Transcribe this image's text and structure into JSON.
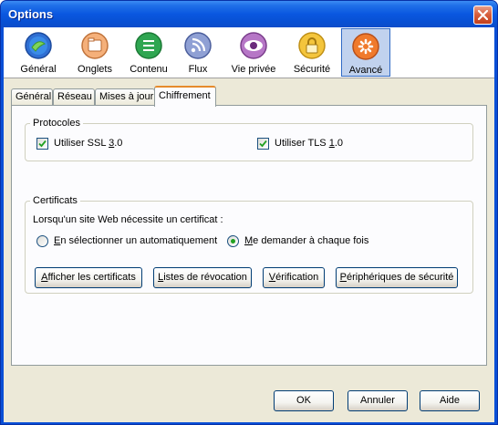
{
  "window": {
    "title": "Options"
  },
  "toolbar": {
    "items": [
      {
        "label": "Général",
        "icon": "general-icon"
      },
      {
        "label": "Onglets",
        "icon": "tabs-icon"
      },
      {
        "label": "Contenu",
        "icon": "content-icon"
      },
      {
        "label": "Flux",
        "icon": "feeds-icon"
      },
      {
        "label": "Vie privée",
        "icon": "privacy-icon"
      },
      {
        "label": "Sécurité",
        "icon": "security-icon"
      },
      {
        "label": "Avancé",
        "icon": "advanced-icon",
        "selected": true
      }
    ]
  },
  "subtabs": [
    "Général",
    "Réseau",
    "Mises à jour",
    "Chiffrement"
  ],
  "active_subtab": "Chiffrement",
  "protocols": {
    "title": "Protocoles",
    "ssl": {
      "label_pre": "Utiliser SSL ",
      "label_key": "3",
      "label_post": ".0",
      "checked": true
    },
    "tls": {
      "label_pre": "Utiliser TLS ",
      "label_key": "1",
      "label_post": ".0",
      "checked": true
    }
  },
  "certificates": {
    "title": "Certificats",
    "prompt": "Lorsqu'un site Web nécessite un certificat :",
    "auto": {
      "label_key": "E",
      "label_rest": "n sélectionner un automatiquement",
      "selected": false
    },
    "ask": {
      "label_key": "M",
      "label_rest": "e demander à chaque fois",
      "selected": true
    },
    "buttons": {
      "view_key": "A",
      "view_rest": "fficher les certificats",
      "revocation_key": "L",
      "revocation_rest": "istes de révocation",
      "verification_key": "V",
      "verification_rest": "érification",
      "devices_key": "P",
      "devices_rest": "ériphériques de sécurité"
    }
  },
  "footer": {
    "ok": "OK",
    "cancel": "Annuler",
    "help": "Aide"
  },
  "colors": {
    "title_bar": "#0a57e0",
    "selected_tab_accent": "#e68b2c",
    "check_mark": "#21a121"
  }
}
